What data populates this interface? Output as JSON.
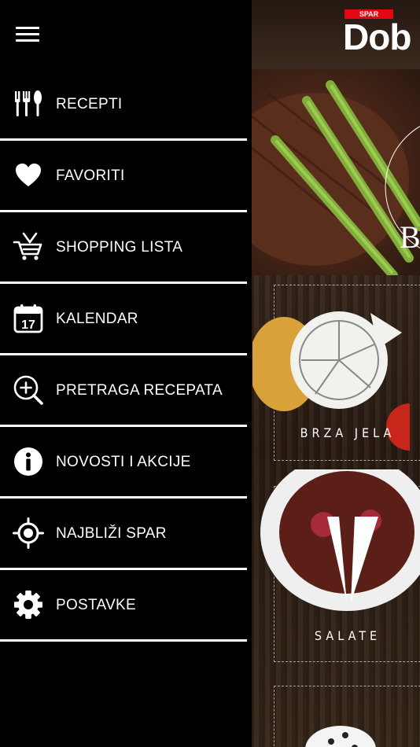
{
  "header": {
    "menu_icon": "hamburger-icon"
  },
  "menu": {
    "items": [
      {
        "label": "RECEPTI",
        "icon": "fork-knife-icon"
      },
      {
        "label": "FAVORITI",
        "icon": "heart-icon"
      },
      {
        "label": "SHOPPING LISTA",
        "icon": "shopping-cart-icon"
      },
      {
        "label": "KALENDAR",
        "icon": "calendar-icon",
        "day": "17"
      },
      {
        "label": "PRETRAGA RECEPATA",
        "icon": "search-plus-icon"
      },
      {
        "label": "NOVOSTI I AKCIJE",
        "icon": "info-icon"
      },
      {
        "label": "NAJBLIŽI SPAR",
        "icon": "location-target-icon"
      },
      {
        "label": "POSTAVKE",
        "icon": "gear-icon"
      }
    ]
  },
  "background": {
    "logo_badge": "SPAR",
    "logo_text": "Dob",
    "hero_letter": "B",
    "tiles": [
      {
        "label": "BRZA JELA"
      },
      {
        "label": "SALATE"
      }
    ],
    "colors": {
      "brand_red": "#e30613",
      "wood": "#3a2a1e"
    }
  },
  "colors": {
    "drawer_bg": "#000000",
    "text": "#ffffff",
    "divider": "#ffffff"
  }
}
